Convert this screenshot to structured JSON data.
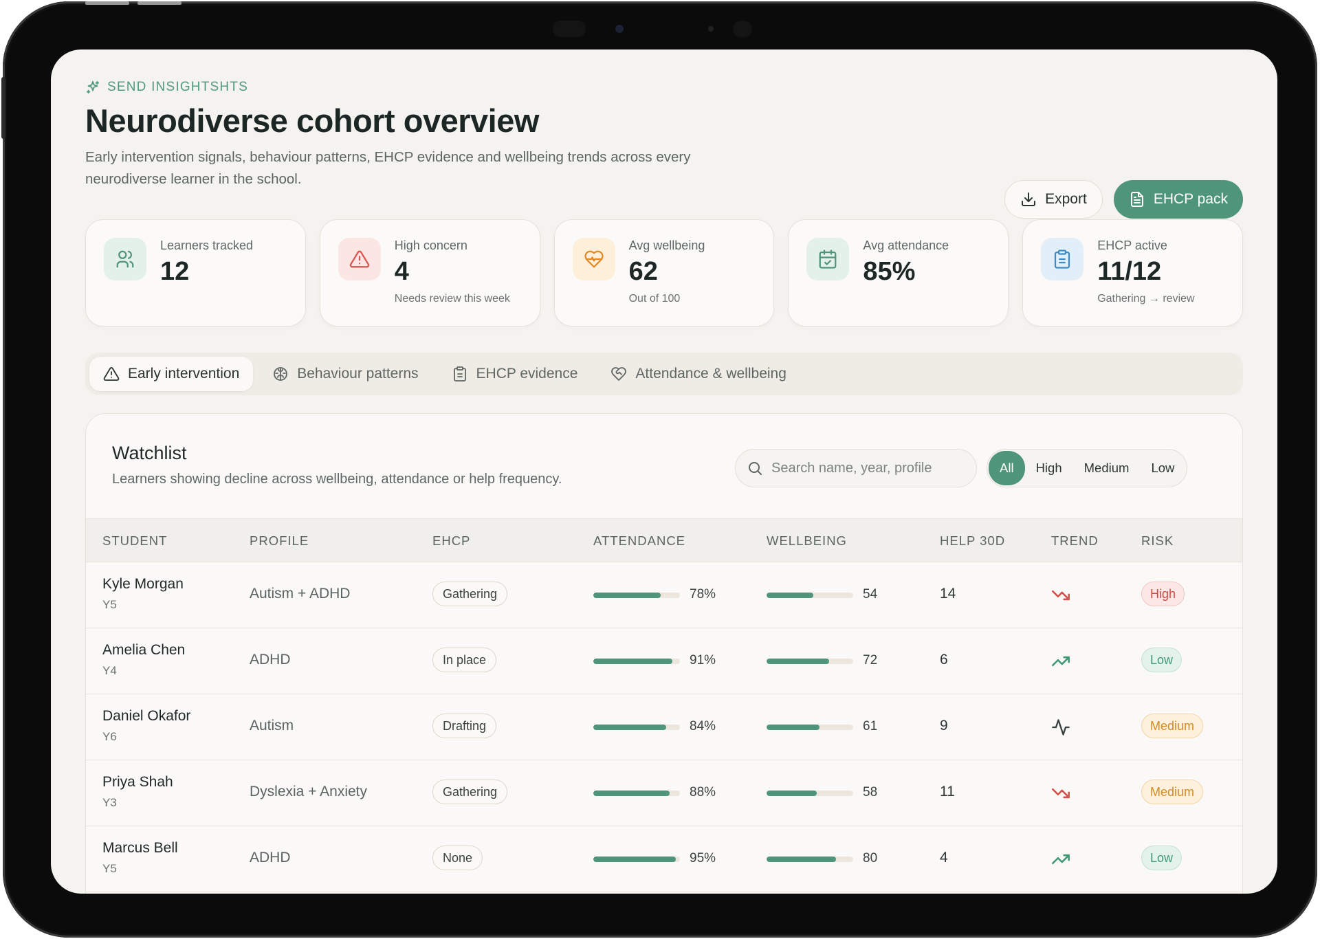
{
  "header": {
    "eyebrow": "SEND INSIGHTSHTS",
    "title": "Neurodiverse cohort overview",
    "subtitle": "Early intervention signals, behaviour patterns, EHCP evidence and wellbeing trends across every neurodiverse learner in the school.",
    "export_label": "Export",
    "ehcp_pack_label": "EHCP pack"
  },
  "stats": [
    {
      "label": "Learners tracked",
      "value": "12",
      "note": "",
      "icon": "users-icon"
    },
    {
      "label": "High concern",
      "value": "4",
      "note": "Needs review this week",
      "icon": "alert-triangle-icon"
    },
    {
      "label": "Avg wellbeing",
      "value": "62",
      "note": "Out of 100",
      "icon": "heart-pulse-icon"
    },
    {
      "label": "Avg attendance",
      "value": "85%",
      "note": "",
      "icon": "calendar-check-icon"
    },
    {
      "label": "EHCP active",
      "value": "11/12",
      "note": "Gathering → review",
      "icon": "clipboard-icon"
    }
  ],
  "tabs": [
    {
      "label": "Early intervention",
      "icon": "alert-triangle-icon",
      "active": true
    },
    {
      "label": "Behaviour patterns",
      "icon": "brain-icon",
      "active": false
    },
    {
      "label": "EHCP evidence",
      "icon": "clipboard-icon",
      "active": false
    },
    {
      "label": "Attendance & wellbeing",
      "icon": "heart-handshake-icon",
      "active": false
    }
  ],
  "watchlist": {
    "title": "Watchlist",
    "subtitle": "Learners showing decline across wellbeing, attendance or help frequency.",
    "search_placeholder": "Search name, year, profile",
    "filters": [
      "All",
      "High",
      "Medium",
      "Low"
    ],
    "active_filter": "All",
    "columns": [
      "STUDENT",
      "PROFILE",
      "EHCP",
      "ATTENDANCE",
      "WELLBEING",
      "HELP 30D",
      "TREND",
      "RISK"
    ],
    "rows": [
      {
        "name": "Kyle Morgan",
        "year": "Y5",
        "profile": "Autism + ADHD",
        "ehcp": "Gathering",
        "attendance": 78,
        "attendance_label": "78%",
        "wellbeing": 54,
        "wellbeing_label": "54",
        "help": "14",
        "trend": "trending-down-icon",
        "risk": "High"
      },
      {
        "name": "Amelia Chen",
        "year": "Y4",
        "profile": "ADHD",
        "ehcp": "In place",
        "attendance": 91,
        "attendance_label": "91%",
        "wellbeing": 72,
        "wellbeing_label": "72",
        "help": "6",
        "trend": "trending-up-icon",
        "risk": "Low"
      },
      {
        "name": "Daniel Okafor",
        "year": "Y6",
        "profile": "Autism",
        "ehcp": "Drafting",
        "attendance": 84,
        "attendance_label": "84%",
        "wellbeing": 61,
        "wellbeing_label": "61",
        "help": "9",
        "trend": "activity-icon",
        "risk": "Medium"
      },
      {
        "name": "Priya Shah",
        "year": "Y3",
        "profile": "Dyslexia + Anxiety",
        "ehcp": "Gathering",
        "attendance": 88,
        "attendance_label": "88%",
        "wellbeing": 58,
        "wellbeing_label": "58",
        "help": "11",
        "trend": "trending-down-icon",
        "risk": "Medium"
      },
      {
        "name": "Marcus Bell",
        "year": "Y5",
        "profile": "ADHD",
        "ehcp": "None",
        "attendance": 95,
        "attendance_label": "95%",
        "wellbeing": 80,
        "wellbeing_label": "80",
        "help": "4",
        "trend": "trending-up-icon",
        "risk": "Low"
      }
    ]
  },
  "colors": {
    "accent": "#4f957a",
    "high": "#cf4a45",
    "medium": "#d68a22",
    "low": "#3f9a74",
    "icon_users_bg": "#e3f1ea",
    "icon_alert_bg": "#fbe6e4",
    "icon_heart_bg": "#fdefd9",
    "icon_calendar_bg": "#e3f1ea",
    "icon_clipboard_bg": "#e2eff8"
  }
}
